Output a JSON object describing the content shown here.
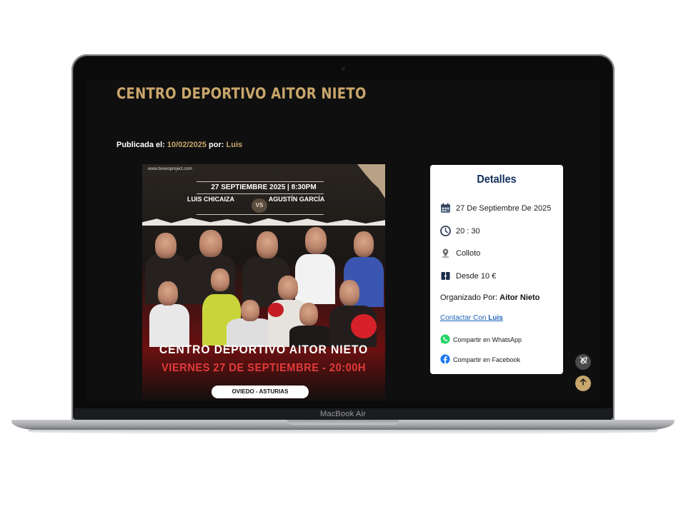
{
  "device": {
    "label": "MacBook Air"
  },
  "page": {
    "title": "CENTRO DEPORTIVO AITOR NIETO",
    "published_label": "Publicada el:",
    "published_date": "10/02/2025",
    "by_label": "por:",
    "author": "Luis"
  },
  "poster": {
    "site": "www.boxeoproject.com",
    "date_line": "27 SEPTIEMBRE 2025 | 8:30PM",
    "fighter1": "LUIS CHICAIZA",
    "vs": "VS",
    "fighter2": "AGUSTÍN GARCÍA",
    "headline": "CENTRO DEPORTIVO AITOR NIETO",
    "subline": "VIERNES 27 DE SEPTIEMBRE - 20:00H",
    "location": "OVIEDO - ASTURIAS"
  },
  "details": {
    "title": "Detalles",
    "date": "27 De Septiembre De 2025",
    "time": "20 : 30",
    "place": "Colloto",
    "price": "Desde 10 €",
    "organizer_label": "Organizado Por:",
    "organizer": "Aitor Nieto",
    "contact_label": "Contactar Con",
    "contact_name": "Luis",
    "share_whatsapp": "Compartir en WhatsApp",
    "share_facebook": "Compartir en Facebook"
  },
  "colors": {
    "accent_gold": "#c9a66b",
    "title_navy": "#0f2d5b",
    "whatsapp": "#25d366",
    "facebook": "#1877f2",
    "link": "#1c63b8"
  },
  "icons": [
    "calendar-icon",
    "clock-icon",
    "location-icon",
    "ticket-icon",
    "whatsapp-icon",
    "facebook-icon",
    "leaf-off-icon",
    "arrow-up-icon"
  ]
}
